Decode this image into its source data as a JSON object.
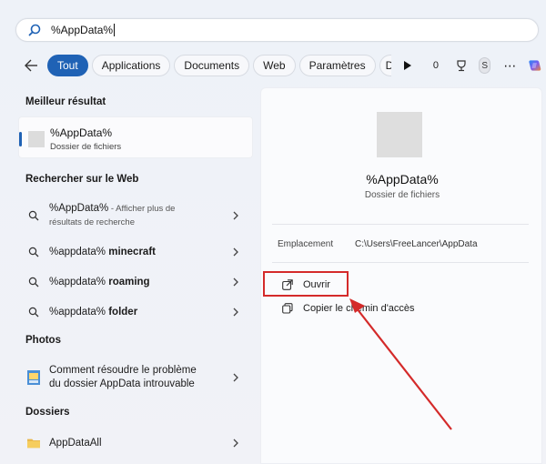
{
  "search": {
    "value": "%AppData%"
  },
  "filters": {
    "tabs": [
      "Tout",
      "Applications",
      "Documents",
      "Web",
      "Paramètres",
      "D"
    ],
    "active": "Tout",
    "count": "0",
    "avatar_letter": "S"
  },
  "left": {
    "best_match_title": "Meilleur résultat",
    "best_match": {
      "title": "%AppData%",
      "subtitle": "Dossier de fichiers"
    },
    "web_title": "Rechercher sur le Web",
    "web_items": [
      {
        "bold_part": "%AppData%",
        "rest": " - Afficher plus de",
        "line2": "résultats de recherche"
      },
      {
        "prefix": "%appdata% ",
        "bold": "minecraft"
      },
      {
        "prefix": "%appdata% ",
        "bold": "roaming"
      },
      {
        "prefix": "%appdata% ",
        "bold": "folder"
      }
    ],
    "photos_title": "Photos",
    "photo_item": {
      "line1": "Comment résoudre le problème",
      "line2": "du dossier AppData introuvable"
    },
    "folders_title": "Dossiers",
    "folder_item": "AppDataAll"
  },
  "right": {
    "title": "%AppData%",
    "subtitle": "Dossier de fichiers",
    "location_label": "Emplacement",
    "location_value": "C:\\Users\\FreeLancer\\AppData",
    "open_label": "Ouvrir",
    "copy_path_label": "Copier le chemin d'accès"
  },
  "colors": {
    "accent": "#1f62b5",
    "highlight": "#d42a2a"
  }
}
